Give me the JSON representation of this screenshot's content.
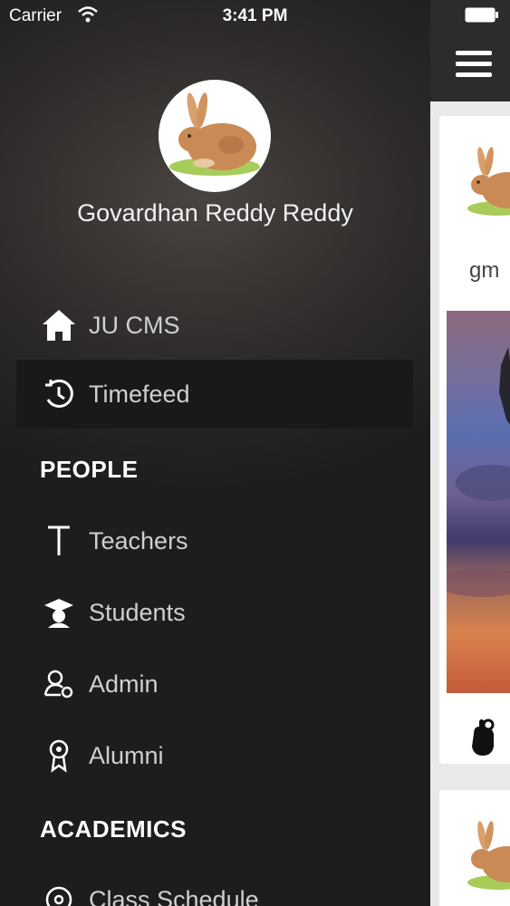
{
  "status_bar": {
    "carrier": "Carrier",
    "time": "3:41 PM"
  },
  "drawer": {
    "user_name": "Govardhan Reddy Reddy",
    "menu": [
      {
        "label": "JU CMS",
        "icon": "home-icon"
      },
      {
        "label": "Timefeed",
        "icon": "clock-icon",
        "selected": true
      }
    ],
    "sections": [
      {
        "title": "PEOPLE",
        "items": [
          {
            "label": "Teachers",
            "icon": "teacher-icon"
          },
          {
            "label": "Students",
            "icon": "graduation-cap-icon"
          },
          {
            "label": "Admin",
            "icon": "admin-icon"
          },
          {
            "label": "Alumni",
            "icon": "ribbon-badge-icon"
          }
        ]
      },
      {
        "title": "ACADEMICS",
        "items": [
          {
            "label": "Class Schedule",
            "icon": "schedule-icon"
          }
        ]
      }
    ]
  },
  "feed": {
    "card_author_fragment": "gm"
  },
  "colors": {
    "drawer_bg": "#2e2b2a",
    "selected_bg": "#1a1918",
    "topbar": "#2c2c2c"
  }
}
